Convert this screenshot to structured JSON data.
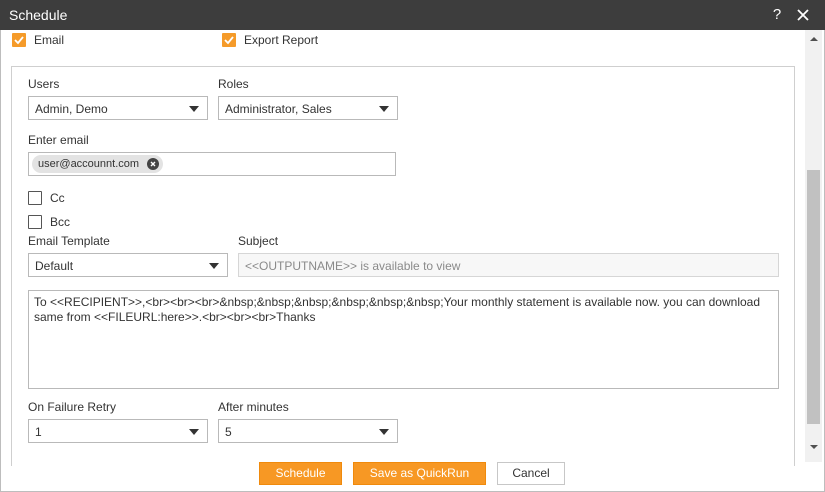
{
  "dialog": {
    "title": "Schedule",
    "help_glyph": "?",
    "close_glyph": "✕"
  },
  "delivery": {
    "email_label": "Email",
    "export_report_label": "Export Report"
  },
  "users": {
    "label": "Users",
    "value": "Admin, Demo"
  },
  "roles": {
    "label": "Roles",
    "value": "Administrator, Sales"
  },
  "enter_email": {
    "label": "Enter email",
    "chip": "user@accounnt.com"
  },
  "cc": {
    "label": "Cc"
  },
  "bcc": {
    "label": "Bcc"
  },
  "email_template": {
    "label": "Email Template",
    "value": "Default"
  },
  "subject": {
    "label": "Subject",
    "placeholder": "<<OUTPUTNAME>> is available to view"
  },
  "body": {
    "line1": "To <<RECIPIENT>>,<br><br><br>&nbsp;&nbsp;&nbsp;&nbsp;&nbsp;&nbsp;Your monthly statement is available now. you can download",
    "line2": "same from <<FILEURL:here>>.<br><br><br>Thanks"
  },
  "on_failure_retry": {
    "label": "On Failure Retry",
    "value": "1"
  },
  "after_minutes": {
    "label": "After minutes",
    "value": "5"
  },
  "footer": {
    "schedule_label": "Schedule",
    "quickrun_label": "Save as QuickRun",
    "cancel_label": "Cancel"
  },
  "colors": {
    "accent": "#f79824",
    "titlebar": "#3d3d3d"
  }
}
